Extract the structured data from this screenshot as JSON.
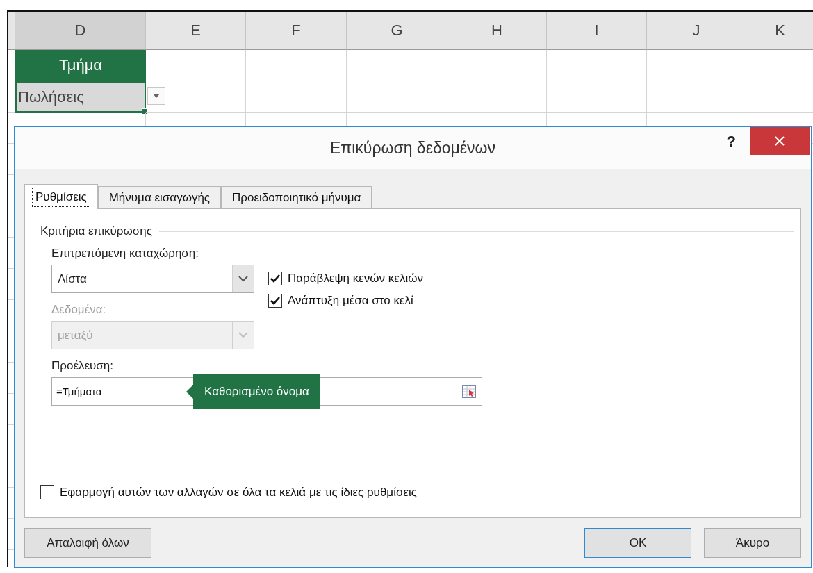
{
  "spreadsheet": {
    "columns": [
      {
        "label": "D",
        "selected": true
      },
      {
        "label": "E",
        "selected": false
      },
      {
        "label": "F",
        "selected": false
      },
      {
        "label": "G",
        "selected": false
      },
      {
        "label": "H",
        "selected": false
      },
      {
        "label": "I",
        "selected": false
      },
      {
        "label": "J",
        "selected": false
      },
      {
        "label": "K",
        "selected": false
      }
    ],
    "cells": [
      {
        "text": "Τμήμα",
        "kind": "header"
      },
      {
        "text": "Πωλήσεις",
        "kind": "active"
      }
    ]
  },
  "dialog": {
    "title": "Επικύρωση δεδομένων",
    "help": "?",
    "tabs": [
      {
        "label": "Ρυθμίσεις",
        "selected": true
      },
      {
        "label": "Μήνυμα εισαγωγής",
        "selected": false
      },
      {
        "label": "Προειδοποιητικό μήνυμα",
        "selected": false
      }
    ],
    "group_label": "Κριτήρια επικύρωσης",
    "allow": {
      "label": "Επιτρεπόμενη καταχώρηση:",
      "value": "Λίστα",
      "disabled": false
    },
    "checkboxes": [
      {
        "label": "Παράβλεψη κενών κελιών",
        "checked": true
      },
      {
        "label": "Ανάπτυξη μέσα στο κελί",
        "checked": true
      }
    ],
    "data": {
      "label": "Δεδομένα:",
      "value": "μεταξύ",
      "disabled": true
    },
    "source": {
      "label": "Προέλευση:",
      "value": "=Τμήματα"
    },
    "tooltip": {
      "text": "Καθορισμένο όνομα"
    },
    "apply_all": {
      "label": "Εφαρμογή αυτών των αλλαγών σε όλα τα κελιά με τις ίδιες ρυθμίσεις",
      "checked": false
    },
    "buttons": [
      {
        "label": "Απαλοιφή όλων",
        "default": false
      },
      {
        "label": "OK",
        "default": true
      },
      {
        "label": "Άκυρο",
        "default": false
      }
    ]
  }
}
